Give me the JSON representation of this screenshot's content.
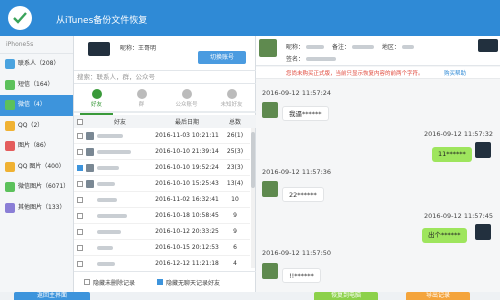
{
  "app": {
    "title": "从iTunes备份文件恢复"
  },
  "sidebar": {
    "device": "iPhone5s",
    "items": [
      {
        "label": "联系人（208）",
        "icon": "contacts-icon",
        "color": "#4aa3df"
      },
      {
        "label": "短信（164）",
        "icon": "sms-icon",
        "color": "#5cc15c"
      },
      {
        "label": "微信（4）",
        "icon": "wechat-icon",
        "color": "#5cc15c"
      },
      {
        "label": "QQ（2）",
        "icon": "qq-icon",
        "color": "#f0b233"
      },
      {
        "label": "图片（86）",
        "icon": "photos-icon",
        "color": "#e45d5d"
      },
      {
        "label": "QQ 图片（400）",
        "icon": "qq-photos-icon",
        "color": "#f0b233"
      },
      {
        "label": "微信图片（6071）",
        "icon": "wechat-photos-icon",
        "color": "#5cc15c"
      },
      {
        "label": "其他图片（133）",
        "icon": "other-photos-icon",
        "color": "#8a7ed6"
      }
    ]
  },
  "account": {
    "name": "昵称：王哥明",
    "switch": "切换账号"
  },
  "search": {
    "placeholder": "搜索：联系人，群，公众号"
  },
  "tabs": [
    {
      "label": "好友",
      "icon": "friend-icon"
    },
    {
      "label": "群",
      "icon": "group-icon"
    },
    {
      "label": "公众账号",
      "icon": "public-account-icon"
    },
    {
      "label": "未知好友",
      "icon": "unknown-friend-icon"
    }
  ],
  "table": {
    "headers": [
      "好友",
      "最后日期",
      "总数"
    ],
    "rows": [
      {
        "time": "2016-11-03 10:21:11",
        "total": "26(1)",
        "checked": false
      },
      {
        "time": "2016-10-10 21:39:14",
        "total": "25(3)",
        "checked": false
      },
      {
        "time": "2016-10-10 19:52:24",
        "total": "23(3)",
        "checked": true
      },
      {
        "time": "2016-10-10 15:25:43",
        "total": "13(4)",
        "checked": false
      },
      {
        "time": "2016-11-02 16:32:41",
        "total": "10",
        "checked": false
      },
      {
        "time": "2016-10-18 10:58:45",
        "total": "9",
        "checked": false
      },
      {
        "time": "2016-10-12 20:33:25",
        "total": "9",
        "checked": false
      },
      {
        "time": "2016-10-15 20:12:53",
        "total": "6",
        "checked": false
      },
      {
        "time": "2016-12-12 11:21:18",
        "total": "4",
        "checked": false
      }
    ]
  },
  "footer": {
    "opt1": "隐藏未删除记录",
    "opt2": "隐藏无聊天记录好友",
    "opt2_checked": true
  },
  "chat": {
    "head": {
      "nick": "昵称：",
      "note": "备注：",
      "area": "地区：",
      "sign": "签名："
    },
    "notice": "您尚未购买正式版，当前只显示恢复内容的前两个字符。",
    "help": "购买帮助",
    "messages": [
      {
        "time": "2016-09-12 11:57:24",
        "text": "我逼******",
        "side": "in"
      },
      {
        "time": "2016-09-12 11:57:32",
        "text": "11******",
        "side": "out"
      },
      {
        "time": "2016-09-12 11:57:36",
        "text": "22******",
        "side": "in"
      },
      {
        "time": "2016-09-12 11:57:45",
        "text": "出个******",
        "side": "out"
      },
      {
        "time": "2016-09-12 11:57:50",
        "text": "!!******",
        "side": "in"
      }
    ]
  },
  "bottom": {
    "back": "返回主界面",
    "btn2": "恢复到电脑",
    "btn3": "导出记录"
  }
}
